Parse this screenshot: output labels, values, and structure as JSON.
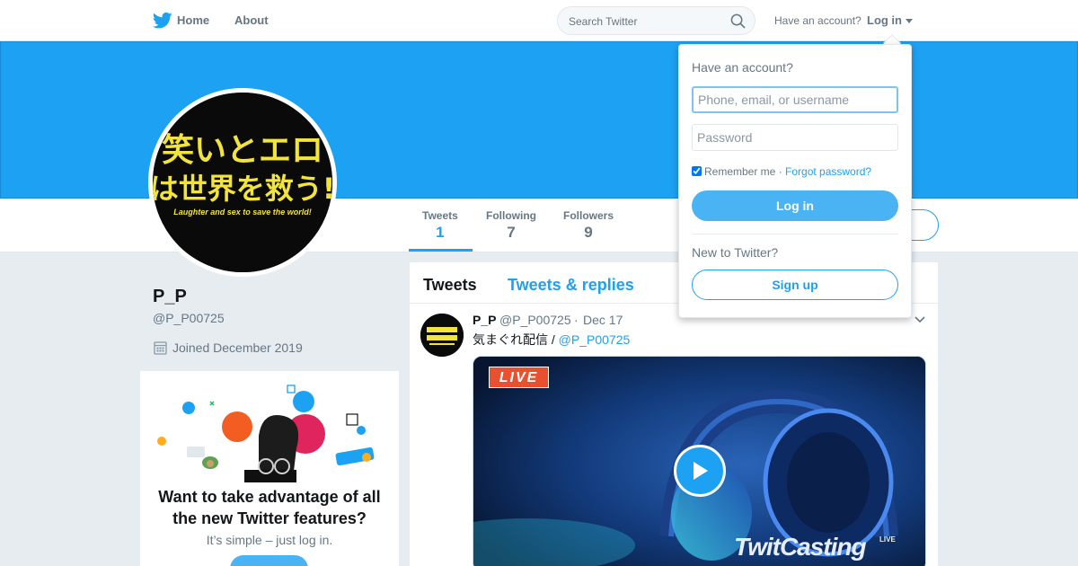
{
  "nav": {
    "home_label": "Home",
    "about_label": "About",
    "search_placeholder": "Search Twitter",
    "have_account_label": "Have an account?",
    "login_label": "Log in"
  },
  "colors": {
    "brand_blue": "#1da1f2",
    "button_blue": "#4ab3f4",
    "live_red": "#e8502f",
    "text_secondary": "#657786"
  },
  "profile": {
    "avatar_text_line1": "笑いとエロ",
    "avatar_text_line2": "は世界を救う!",
    "avatar_text_en": "Laughter and sex to save the world!",
    "display_name": "P_P",
    "handle": "@P_P00725",
    "joined": "Joined December 2019"
  },
  "stats": [
    {
      "label": "Tweets",
      "value": "1"
    },
    {
      "label": "Following",
      "value": "7"
    },
    {
      "label": "Followers",
      "value": "9"
    }
  ],
  "promo": {
    "title": "Want to take advantage of all the new Twitter features?",
    "subtitle": "It’s simple – just log in."
  },
  "timeline": {
    "tabs": [
      "Tweets",
      "Tweets & replies"
    ],
    "tweet": {
      "name": "P_P",
      "handle": "@P_P00725",
      "separator": "·",
      "date": "Dec 17",
      "text": "気まぐれ配信 / ",
      "mention": "@P_P00725",
      "media_badge": "LIVE",
      "media_logo": "TwitCasting",
      "media_logo_sup": "LIVE"
    }
  },
  "login_dropdown": {
    "title": "Have an account?",
    "username_placeholder": "Phone, email, or username",
    "password_placeholder": "Password",
    "remember_label": "Remember me",
    "separator": " · ",
    "forgot_label": "Forgot password?",
    "login_button": "Log in",
    "new_to_twitter": "New to Twitter?",
    "signup_button": "Sign up"
  }
}
